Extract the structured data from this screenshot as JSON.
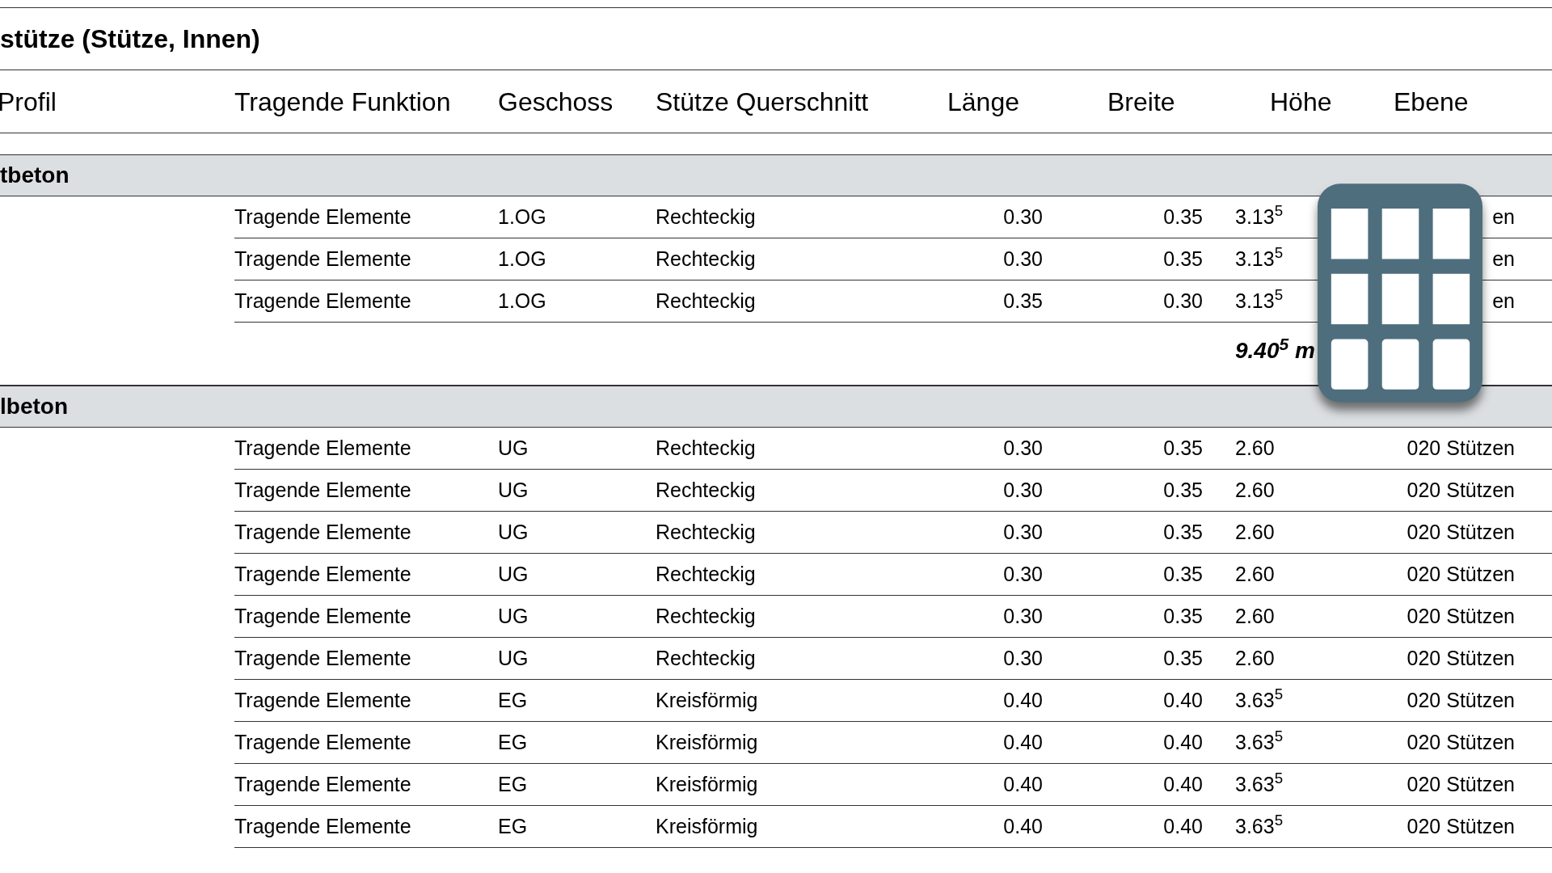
{
  "title": "stütze (Stütze, Innen)",
  "columns": [
    "Profil",
    "Tragende Funktion",
    "Geschoss",
    "Stütze Querschnitt",
    "Länge",
    "Breite",
    "Höhe",
    "Ebene"
  ],
  "groups": [
    {
      "name": "tbeton",
      "rows": [
        [
          "Tragende Elemente",
          "1.OG",
          "Rechteckig",
          "0.30",
          "0.35",
          "3.13$^{5}$",
          "en"
        ],
        [
          "Tragende Elemente",
          "1.OG",
          "Rechteckig",
          "0.30",
          "0.35",
          "3.13$^{5}$",
          "en"
        ],
        [
          "Tragende Elemente",
          "1.OG",
          "Rechteckig",
          "0.35",
          "0.30",
          "3.13$^{5}$",
          "en"
        ]
      ],
      "total": "9.40$^{5}$ m"
    },
    {
      "name": "lbeton",
      "rows": [
        [
          "Tragende Elemente",
          "UG",
          "Rechteckig",
          "0.30",
          "0.35",
          "2.60",
          "020 Stützen"
        ],
        [
          "Tragende Elemente",
          "UG",
          "Rechteckig",
          "0.30",
          "0.35",
          "2.60",
          "020 Stützen"
        ],
        [
          "Tragende Elemente",
          "UG",
          "Rechteckig",
          "0.30",
          "0.35",
          "2.60",
          "020 Stützen"
        ],
        [
          "Tragende Elemente",
          "UG",
          "Rechteckig",
          "0.30",
          "0.35",
          "2.60",
          "020 Stützen"
        ],
        [
          "Tragende Elemente",
          "UG",
          "Rechteckig",
          "0.30",
          "0.35",
          "2.60",
          "020 Stützen"
        ],
        [
          "Tragende Elemente",
          "UG",
          "Rechteckig",
          "0.30",
          "0.35",
          "2.60",
          "020 Stützen"
        ],
        [
          "Tragende Elemente",
          "EG",
          "Kreisförmig",
          "0.40",
          "0.40",
          "3.63$^{5}$",
          "020 Stützen"
        ],
        [
          "Tragende Elemente",
          "EG",
          "Kreisförmig",
          "0.40",
          "0.40",
          "3.63$^{5}$",
          "020 Stützen"
        ],
        [
          "Tragende Elemente",
          "EG",
          "Kreisförmig",
          "0.40",
          "0.40",
          "3.63$^{5}$",
          "020 Stützen"
        ],
        [
          "Tragende Elemente",
          "EG",
          "Kreisförmig",
          "0.40",
          "0.40",
          "3.63$^{5}$",
          "020 Stützen"
        ]
      ]
    }
  ]
}
